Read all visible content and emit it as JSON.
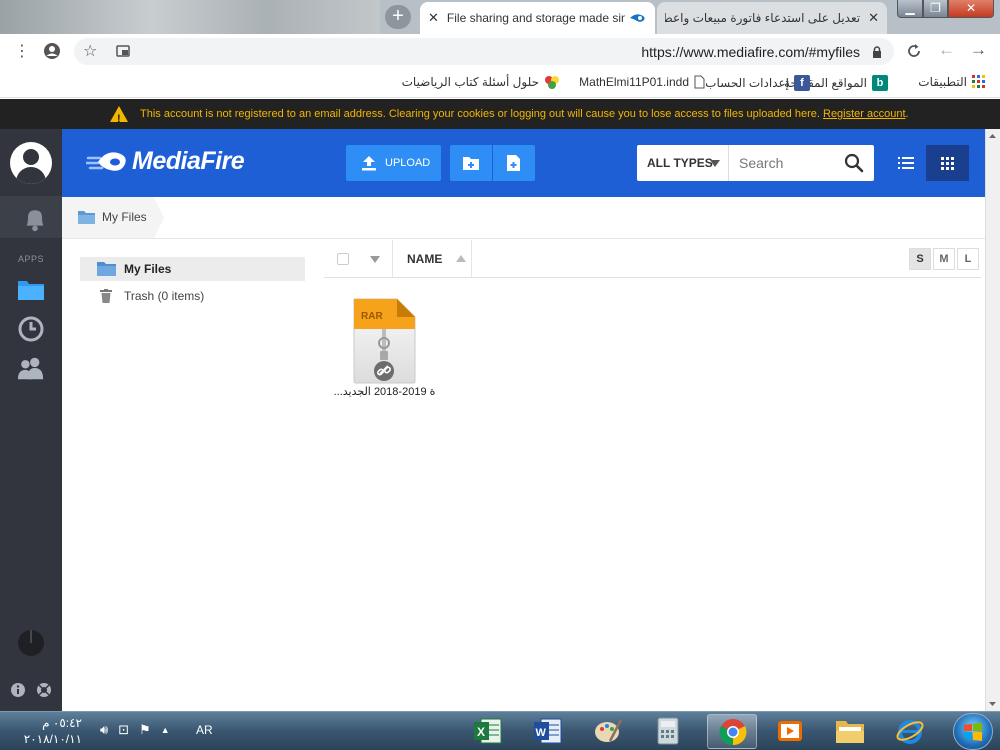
{
  "browser": {
    "tabs": [
      {
        "title": "File sharing and storage made simple",
        "active": true
      },
      {
        "title": "تعديل على استدعاء فاتورة مبيعات واعطاء رقم",
        "active": false
      }
    ],
    "url": "https://www.mediafire.com/#myfiles",
    "bookmarks": [
      {
        "label": "التطبيقات",
        "icon": "apps-grid-icon"
      },
      {
        "label": "المواقع المقترحة",
        "icon": "bing-icon"
      },
      {
        "label": "إعدادات الحساب",
        "icon": "facebook-icon"
      },
      {
        "label": "MathElmi11P01.indd",
        "icon": "page-icon"
      },
      {
        "label": "حلول أسئلة كتاب الرياضيات",
        "icon": "bookmark-colorful-icon"
      }
    ]
  },
  "warning": {
    "message": "This account is not registered to an email address. Clearing your cookies or logging out will cause you to lose access to files uploaded here.",
    "link": "Register account",
    "suffix": "."
  },
  "header": {
    "logo": "MediaFire",
    "upload_label": "UPLOAD",
    "filter_label": "ALL TYPES",
    "search_placeholder": "Search"
  },
  "rail": {
    "apps_label": "APPS"
  },
  "breadcrumb": {
    "current": "My Files"
  },
  "tree": [
    {
      "label": "My Files",
      "selected": true
    },
    {
      "label": "Trash (0 items)",
      "selected": false
    }
  ],
  "columns": {
    "name": "NAME",
    "sizes": [
      "S",
      "M",
      "L"
    ],
    "active_size": "S"
  },
  "files": [
    {
      "name": "...ة 2019-2018 الجديد",
      "type": "RAR"
    }
  ],
  "taskbar": {
    "time": "٠٥:٤٢ م",
    "date": "٢٠١٨/١٠/١١",
    "lang": "AR"
  },
  "colors": {
    "brand_blue": "#1f5fd6",
    "button_blue": "#2f8ef6",
    "warning_yellow": "#f2b600",
    "rail_dark": "#32353d"
  }
}
